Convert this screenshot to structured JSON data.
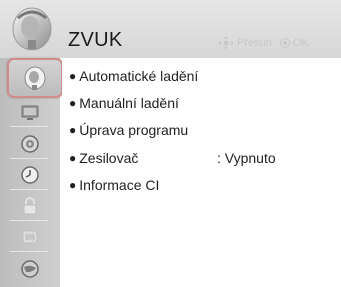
{
  "header": {
    "title": "ZVUK",
    "hint_move": "Přesun",
    "hint_ok": "OK"
  },
  "sidebar": {
    "items": [
      {
        "icon": "satellite-dish-icon",
        "selected": true
      },
      {
        "icon": "picture-monitor-icon"
      },
      {
        "icon": "speaker-icon"
      },
      {
        "icon": "clock-icon"
      },
      {
        "icon": "lock-icon"
      },
      {
        "icon": "option-film-icon"
      },
      {
        "icon": "globe-icon"
      }
    ]
  },
  "menu": {
    "items": [
      {
        "label": "Automatické ladění"
      },
      {
        "label": "Manuální ladění"
      },
      {
        "label": "Úprava programu"
      },
      {
        "label": "Zesilovač",
        "value": ": Vypnuto"
      },
      {
        "label": "Informace CI"
      }
    ]
  },
  "colors": {
    "header_bg": "#dcdcdc",
    "sidebar_bg": "#c4c4c4",
    "selection_border": "#d28b8b",
    "hint_text": "#c8c8c8"
  }
}
